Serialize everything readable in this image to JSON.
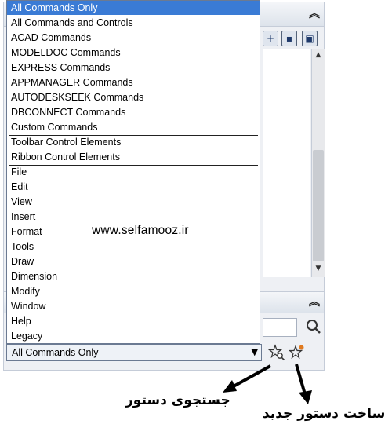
{
  "dropdown": {
    "items": [
      "All Commands Only",
      "All Commands and Controls",
      "ACAD Commands",
      "MODELDOC Commands",
      "EXPRESS Commands",
      "APPMANAGER Commands",
      "AUTODESKSEEK Commands",
      "DBCONNECT Commands",
      "Custom Commands",
      "Toolbar Control Elements",
      "Ribbon Control Elements",
      "File",
      "Edit",
      "View",
      "Insert",
      "Format",
      "Tools",
      "Draw",
      "Dimension",
      "Modify",
      "Window",
      "Help",
      "Legacy"
    ],
    "selected_index": 0
  },
  "combo": {
    "value": "All Commands Only"
  },
  "watermark": "www.selfamooz.ir",
  "annotations": {
    "search_command": "جستجوی دستور",
    "create_command": "ساخت دستور جدید"
  },
  "icons": {
    "collapse": "double-chevron-up-icon",
    "search": "magnifier-icon",
    "find_command": "star-search-icon",
    "new_command": "star-new-icon"
  },
  "colors": {
    "selection": "#3a7bd5",
    "panel": "#eef0f4"
  }
}
